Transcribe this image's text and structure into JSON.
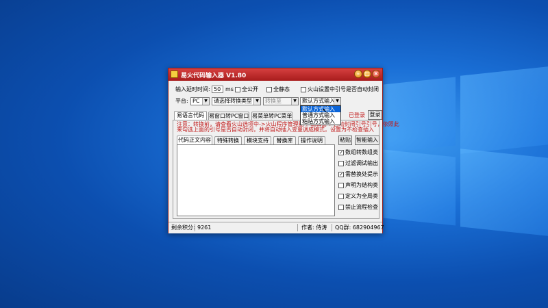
{
  "window": {
    "title": "易火代码输入器 V1.80",
    "minimize_glyph": "–",
    "maximize_glyph": "□",
    "close_glyph": "×"
  },
  "row1": {
    "delay_label": "输入延时时间:",
    "delay_value": "50",
    "delay_unit": "ms",
    "all_public": "全公开",
    "all_static": "全静态",
    "auto_close_label": "火山设置中引号是否自动封闭",
    "auto_close_checked": false
  },
  "row2": {
    "platform_label": "平台:",
    "platform_value": "PC",
    "convert_type": "请选择转换类型",
    "convert_to": "转换至",
    "input_mode": "默认方式输入",
    "logged_in": "已登录",
    "login_button": "登录"
  },
  "input_mode_options": [
    {
      "label": "默认方式输入",
      "selected": true
    },
    {
      "label": "普通方式输入",
      "selected": false
    },
    {
      "label": "粘贴方式输入",
      "selected": false
    }
  ],
  "main_tabs": [
    "易语言代码",
    "易窗口转PC窗口",
    "易菜单转PC菜单"
  ],
  "notice": [
    "注意：转换前，请查看火山选项中->火山程序管理器->编辑器->自动封闭引号引号，依照此",
    "来勾选上面的引号是否自动封闭，并将自动插入变量调成模式，设置为不检查插入"
  ],
  "sub_tabs": [
    "代码正文内容",
    "特殊转换",
    "模块支持",
    "替换库",
    "操作说明"
  ],
  "buttons": {
    "paste": "粘贴",
    "smart_input": "智能输入"
  },
  "options": [
    {
      "label": "数组转数组类",
      "checked": true
    },
    {
      "label": "过滤调试输出",
      "checked": false
    },
    {
      "label": "需替换处提示",
      "checked": true
    },
    {
      "label": "声明为结构类",
      "checked": false
    },
    {
      "label": "定义为全局类",
      "checked": false
    },
    {
      "label": "禁止流程检查",
      "checked": false
    }
  ],
  "status": {
    "points_label": "剩余积分:",
    "points_value": "9261",
    "author": "作者: 侍涛",
    "qq_group": "QQ群: 682904967"
  },
  "colors": {
    "titlebar": "#c02828",
    "notice": "#c01818",
    "selection": "#0a64d8",
    "desktop": "#0c4fb0"
  }
}
